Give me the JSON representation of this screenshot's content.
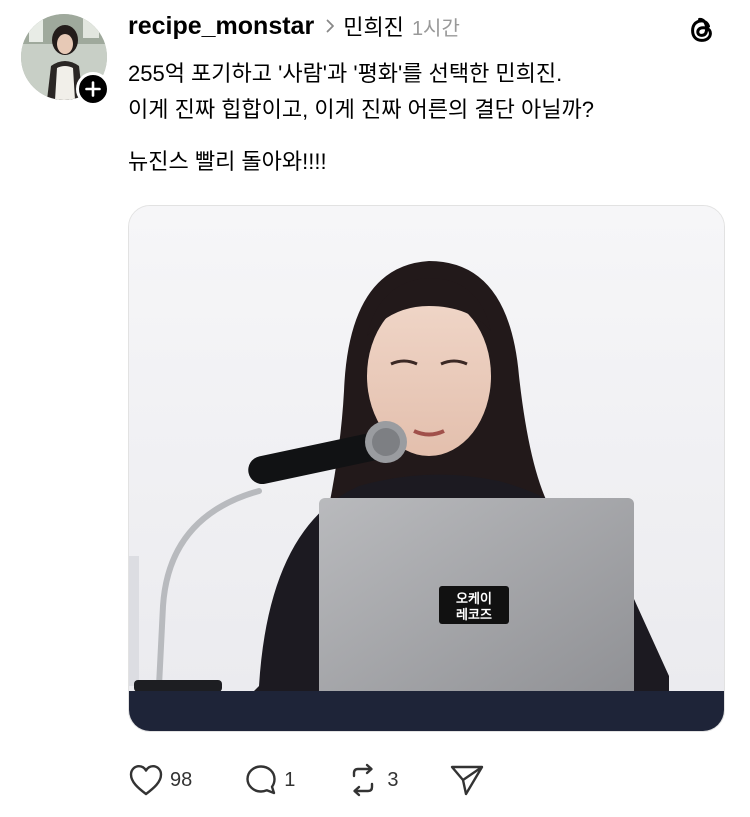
{
  "post": {
    "username": "recipe_monstar",
    "community": "민희진",
    "time": "1시간",
    "text_line1": "255억 포기하고 '사람'과 '평화'를 선택한 민희진.",
    "text_line2": "이게 진짜 힙합이고, 이게 진짜 어른의 결단 아닐까?",
    "text_line3": "뉴진스 빨리 돌아와!!!!",
    "laptop_sticker_line1": "오케이",
    "laptop_sticker_line2": "레코즈"
  },
  "actions": {
    "likes": "98",
    "comments": "1",
    "reposts": "3"
  },
  "icons": {
    "like": "heart-icon",
    "comment": "comment-bubble-icon",
    "repost": "repost-icon",
    "share": "send-icon",
    "app": "threads-logo-icon",
    "follow": "plus-icon",
    "chevron": "chevron-right-icon"
  },
  "colors": {
    "text": "#000000",
    "muted": "#999999"
  }
}
